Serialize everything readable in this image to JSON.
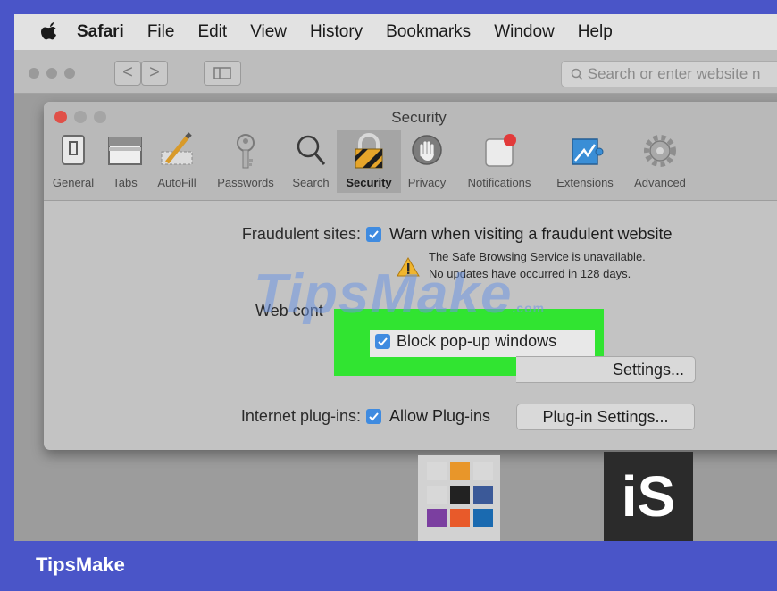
{
  "menubar": {
    "items": [
      "Safari",
      "File",
      "Edit",
      "View",
      "History",
      "Bookmarks",
      "Window",
      "Help"
    ]
  },
  "toolbar": {
    "back_glyph": "<",
    "forward_glyph": ">",
    "address_placeholder": "Search or enter website n"
  },
  "prefs": {
    "title": "Security",
    "tabs": [
      {
        "label": "General",
        "icon": "general-icon"
      },
      {
        "label": "Tabs",
        "icon": "tabs-icon"
      },
      {
        "label": "AutoFill",
        "icon": "autofill-icon"
      },
      {
        "label": "Passwords",
        "icon": "key-icon"
      },
      {
        "label": "Search",
        "icon": "magnifier-icon"
      },
      {
        "label": "Security",
        "icon": "lock-icon",
        "selected": true
      },
      {
        "label": "Privacy",
        "icon": "hand-icon"
      },
      {
        "label": "Notifications",
        "icon": "notification-icon"
      },
      {
        "label": "Extensions",
        "icon": "puzzle-icon"
      },
      {
        "label": "Advanced",
        "icon": "gear-icon"
      }
    ],
    "fraudulent": {
      "label": "Fraudulent sites:",
      "option": "Warn when visiting a fraudulent website",
      "checked": true,
      "note_line1": "The Safe Browsing Service is unavailable.",
      "note_line2": "No updates have occurred in 128 days."
    },
    "web_content": {
      "label": "Web cont",
      "popup_option": "Block pop-up windows",
      "popup_checked": true,
      "settings_button": "Settings..."
    },
    "plugins": {
      "label": "Internet plug-ins:",
      "option": "Allow Plug-ins",
      "checked": true,
      "settings_button": "Plug-in Settings..."
    }
  },
  "watermark": {
    "text": "TipsMake",
    "suffix": ".com"
  },
  "logo_text": "iS",
  "brand": "TipsMake",
  "colors": {
    "frame": "#4a55c8",
    "highlight": "#31e431",
    "checkbox": "#3f8be0"
  }
}
